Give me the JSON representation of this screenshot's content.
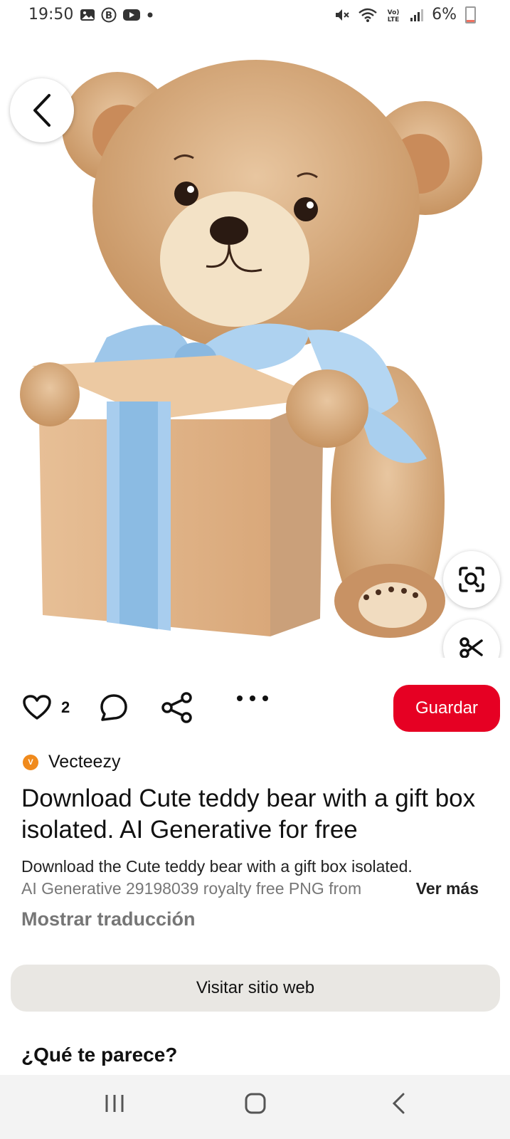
{
  "status_bar": {
    "time": "19:50",
    "battery": "6%",
    "left_icons": [
      "gallery-icon",
      "b-app-icon",
      "youtube-icon",
      "dot-icon"
    ],
    "right_icons": [
      "mute-icon",
      "wifi-icon",
      "volte-icon",
      "signal-icon",
      "battery-icon"
    ]
  },
  "pin": {
    "image": "teddy-bear-with-gift-box",
    "likes": "2",
    "save_label": "Guardar",
    "source": "Vecteezy",
    "title": "Download Cute teddy bear with a gift box isolated. AI Generative for free",
    "description_line1": "Download the Cute teddy bear with a gift box isolated.",
    "description_line2": "AI Generative 29198039 royalty free PNG from",
    "see_more": "Ver más",
    "show_translation": "Mostrar traducción",
    "visit_label": "Visitar sitio web",
    "question": "¿Qué te parece?"
  },
  "colors": {
    "accent": "#e60023",
    "secondary_button": "#e9e7e3",
    "source_logo": "#f08a1c"
  },
  "nav": [
    "recents-icon",
    "home-icon",
    "back-icon"
  ]
}
